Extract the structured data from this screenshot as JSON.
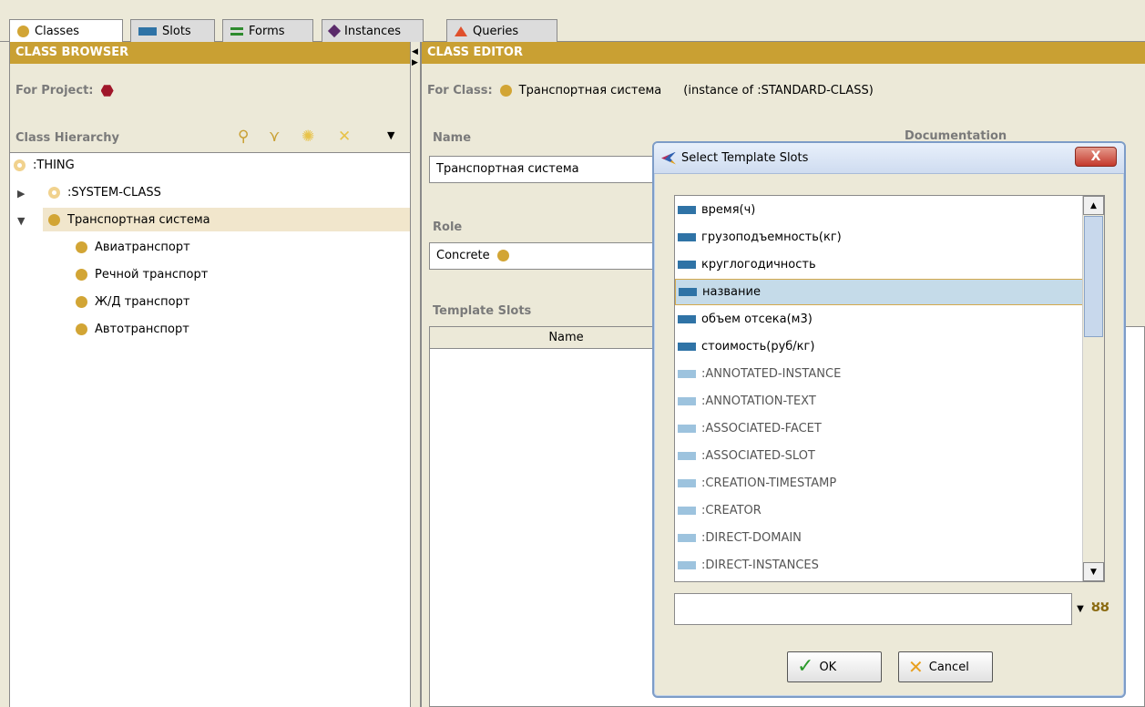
{
  "tabs": [
    {
      "label": "Classes",
      "icon": "class-dot-icon",
      "active": true
    },
    {
      "label": "Slots",
      "icon": "slot-bar-icon"
    },
    {
      "label": "Forms",
      "icon": "forms-icon"
    },
    {
      "label": "Instances",
      "icon": "instance-diamond-icon"
    },
    {
      "label": "Queries",
      "icon": "query-triangle-icon"
    }
  ],
  "class_browser": {
    "header": "CLASS BROWSER",
    "for_project_label": "For Project:",
    "hierarchy_label": "Class Hierarchy",
    "tree": [
      {
        "label": ":THING"
      },
      {
        "label": ":SYSTEM-CLASS"
      },
      {
        "label": "Транспортная система"
      },
      {
        "label": "Авиатранспорт"
      },
      {
        "label": "Речной транспорт"
      },
      {
        "label": "Ж/Д транспорт"
      },
      {
        "label": "Автотранспорт"
      }
    ]
  },
  "class_editor": {
    "header": "CLASS EDITOR",
    "for_class_label": "For Class:",
    "class_name": "Транспортная система",
    "instance_of": "(instance of :STANDARD-CLASS)",
    "name_label": "Name",
    "documentation_label": "Documentation",
    "name_value": "Транспортная система",
    "role_label": "Role",
    "role_value": "Concrete",
    "template_slots_label": "Template Slots",
    "table_col_name": "Name"
  },
  "dialog": {
    "title": "Select Template Slots",
    "close": "X",
    "items": [
      {
        "label": "время(ч)",
        "system": false
      },
      {
        "label": "грузоподъемность(кг)",
        "system": false
      },
      {
        "label": "круглогодичность",
        "system": false
      },
      {
        "label": "название",
        "system": false,
        "selected": true
      },
      {
        "label": "объем отсека(м3)",
        "system": false
      },
      {
        "label": "стоимость(руб/кг)",
        "system": false
      },
      {
        "label": ":ANNOTATED-INSTANCE",
        "system": true
      },
      {
        "label": ":ANNOTATION-TEXT",
        "system": true
      },
      {
        "label": ":ASSOCIATED-FACET",
        "system": true
      },
      {
        "label": ":ASSOCIATED-SLOT",
        "system": true
      },
      {
        "label": ":CREATION-TIMESTAMP",
        "system": true
      },
      {
        "label": ":CREATOR",
        "system": true
      },
      {
        "label": ":DIRECT-DOMAIN",
        "system": true
      },
      {
        "label": ":DIRECT-INSTANCES",
        "system": true
      }
    ],
    "ok_label": "OK",
    "cancel_label": "Cancel"
  },
  "colors": {
    "header": "#c9a033",
    "class_dot": "#d2a535",
    "slot": "#2f73a6",
    "system_slot": "#9dc3de"
  }
}
